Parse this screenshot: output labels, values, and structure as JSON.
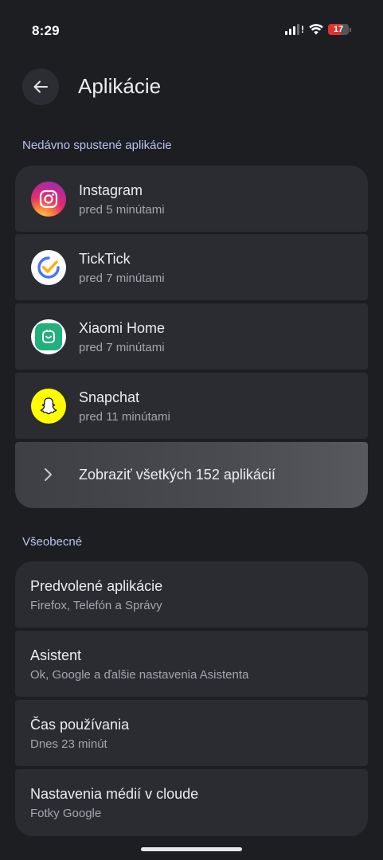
{
  "status_bar": {
    "time": "8:29",
    "battery_level": "17",
    "battery_color": "#e0312f"
  },
  "header": {
    "back_icon": "arrow-left-icon",
    "title": "Aplikácie"
  },
  "recent": {
    "section_title": "Nedávno spustené aplikácie",
    "apps": [
      {
        "name": "Instagram",
        "time": "pred 5 minútami",
        "icon": "instagram-icon"
      },
      {
        "name": "TickTick",
        "time": "pred 7 minútami",
        "icon": "ticktick-icon"
      },
      {
        "name": "Xiaomi Home",
        "time": "pred 7 minútami",
        "icon": "xiaomi-home-icon"
      },
      {
        "name": "Snapchat",
        "time": "pred 11 minútami",
        "icon": "snapchat-icon"
      }
    ],
    "see_all_label": "Zobraziť všetkých 152 aplikácií"
  },
  "general": {
    "section_title": "Všeobecné",
    "items": [
      {
        "title": "Predvolené aplikácie",
        "subtitle": "Firefox, Telefón a Správy"
      },
      {
        "title": "Asistent",
        "subtitle": "Ok, Google a ďalšie nastavenia Asistenta"
      },
      {
        "title": "Čas používania",
        "subtitle": "Dnes 23 minút"
      },
      {
        "title": "Nastavenia médií v cloude",
        "subtitle": "Fotky Google"
      }
    ]
  },
  "colors": {
    "background": "#1d1e22",
    "card": "#2b2c31",
    "accent_section": "#b6c3ee"
  }
}
